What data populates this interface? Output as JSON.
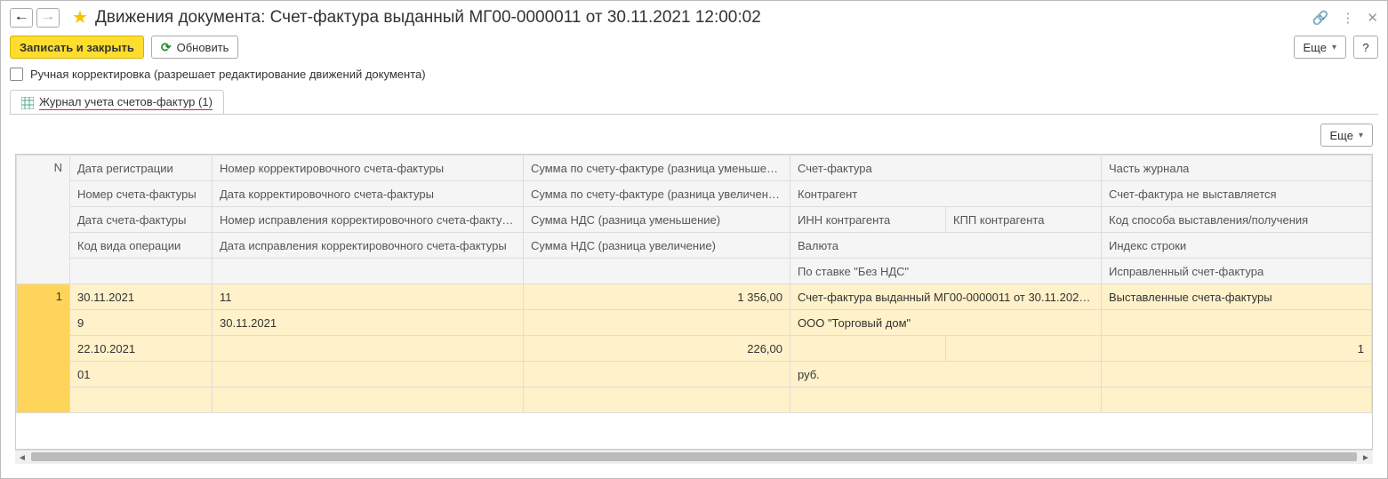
{
  "title": "Движения документа: Счет-фактура выданный МГ00-0000011 от 30.11.2021 12:00:02",
  "buttons": {
    "save_close": "Записать и закрыть",
    "refresh": "Обновить",
    "more": "Еще",
    "help": "?"
  },
  "checkbox_label": "Ручная корректировка (разрешает редактирование движений документа)",
  "tab_label": "Журнал учета счетов-фактур (1)",
  "headers": {
    "n": "N",
    "r1": {
      "c1": "Дата регистрации",
      "c2": "Номер корректировочного счета-фактуры",
      "c3": "Сумма по счету-фактуре (разница уменьшение)",
      "c4": "Счет-фактура",
      "c5": "Часть журнала"
    },
    "r2": {
      "c1": "Номер счета-фактуры",
      "c2": "Дата корректировочного счета-фактуры",
      "c3": "Сумма по счету-фактуре (разница увеличение)",
      "c4": "Контрагент",
      "c5": "Счет-фактура не выставляется"
    },
    "r3": {
      "c1": "Дата счета-фактуры",
      "c2": "Номер исправления корректировочного счета-фактуры",
      "c3": "Сумма НДС (разница уменьшение)",
      "c4a": "ИНН контрагента",
      "c4b": "КПП контрагента",
      "c5": "Код способа выставления/получения"
    },
    "r4": {
      "c1": "Код вида операции",
      "c2": "Дата исправления корректировочного счета-фактуры",
      "c3": "Сумма НДС (разница увеличение)",
      "c4": "Валюта",
      "c5": "Индекс строки"
    },
    "r5": {
      "c4": "По ставке \"Без НДС\"",
      "c5": "Исправленный счет-фактура"
    }
  },
  "row": {
    "n": "1",
    "r1": {
      "c1": "30.11.2021",
      "c2": "11",
      "c3": "1 356,00",
      "c4": "Счет-фактура выданный МГ00-0000011 от 30.11.2021 ...",
      "c5": "Выставленные счета-фактуры"
    },
    "r2": {
      "c1": "9",
      "c2": "30.11.2021",
      "c3": "",
      "c4": "ООО \"Торговый дом\"",
      "c5": ""
    },
    "r3": {
      "c1": "22.10.2021",
      "c2": "",
      "c3": "226,00",
      "c4a": "",
      "c4b": "",
      "c5": "1"
    },
    "r4": {
      "c1": "01",
      "c2": "",
      "c3": "",
      "c4": "руб.",
      "c5": ""
    },
    "r5": {
      "c4": "",
      "c5": ""
    }
  }
}
